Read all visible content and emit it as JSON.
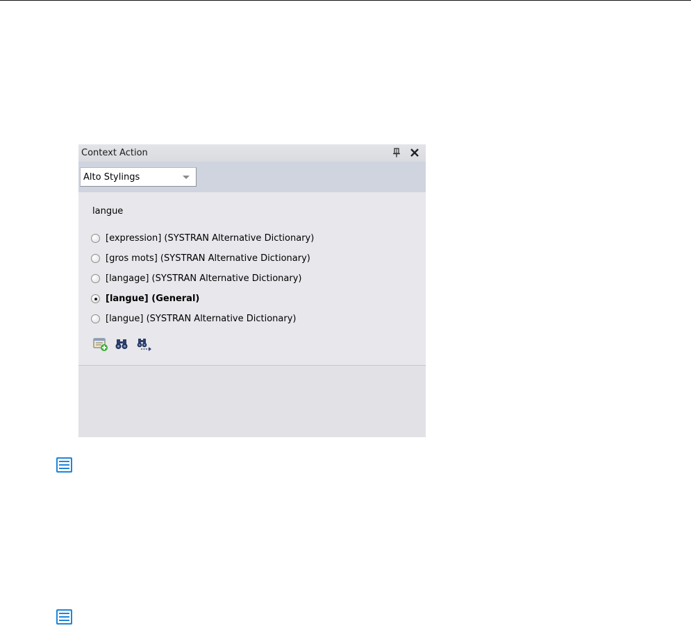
{
  "panel": {
    "title": "Context Action",
    "pin_icon": "pin-icon",
    "close_icon": "close-icon",
    "dropdown": {
      "selected": "Alto Stylings",
      "icon": "chevron-down-icon"
    },
    "source_word": "langue",
    "options": [
      {
        "label": "[expression] (SYSTRAN Alternative Dictionary)",
        "selected": false
      },
      {
        "label": "[gros mots] (SYSTRAN Alternative Dictionary)",
        "selected": false
      },
      {
        "label": "[langage] (SYSTRAN Alternative Dictionary)",
        "selected": false
      },
      {
        "label": "[langue] (General)",
        "selected": true
      },
      {
        "label": "[langue] (SYSTRAN Alternative Dictionary)",
        "selected": false
      }
    ],
    "actions": [
      {
        "icon": "add-dictionary-entry-icon"
      },
      {
        "icon": "find-icon"
      },
      {
        "icon": "find-next-icon"
      }
    ]
  },
  "page_icons": [
    "note-list-icon",
    "note-list-icon"
  ],
  "colors": {
    "panel_bg": "#e1e1e6",
    "toolbar_bg": "#cfd4df",
    "note_icon_blue": "#1e86d8"
  }
}
